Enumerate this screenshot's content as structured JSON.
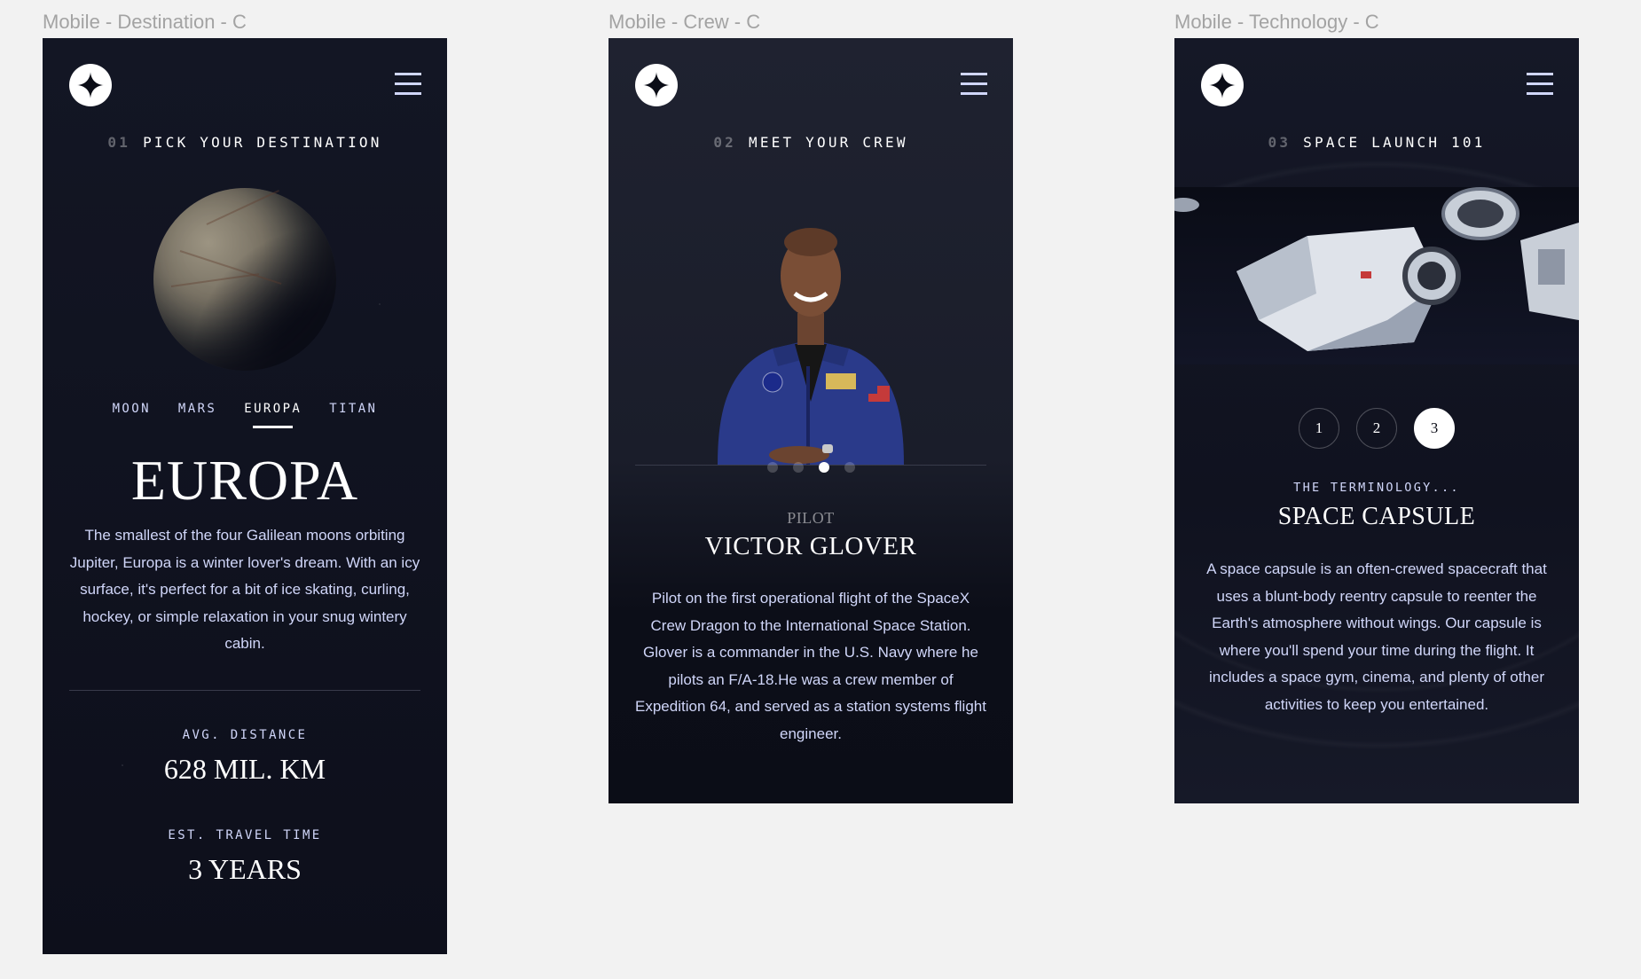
{
  "frames": {
    "destination": {
      "label": "Mobile - Destination - C",
      "eyebrow": {
        "number": "01",
        "text": "PICK YOUR DESTINATION"
      },
      "tabs": [
        "MOON",
        "MARS",
        "EUROPA",
        "TITAN"
      ],
      "active_tab": "EUROPA",
      "name": "EUROPA",
      "description": "The smallest of the four Galilean moons orbiting Jupiter, Europa is a winter lover's dream. With an icy surface, it's perfect for a bit of ice skating, curling, hockey, or simple relaxation in your snug wintery cabin.",
      "distance_label": "AVG. DISTANCE",
      "distance_value": "628 MIL. KM",
      "travel_label": "EST. TRAVEL TIME",
      "travel_value": "3 YEARS"
    },
    "crew": {
      "label": "Mobile - Crew - C",
      "eyebrow": {
        "number": "02",
        "text": "MEET YOUR CREW"
      },
      "dots_count": 4,
      "active_dot": 3,
      "role": "PILOT",
      "name": "VICTOR GLOVER",
      "bio": "Pilot on the first operational flight of the SpaceX Crew Dragon to the International Space Station. Glover is a commander in the U.S. Navy where he pilots an F/A-18.He was a crew member of Expedition 64, and served as a station systems flight engineer."
    },
    "technology": {
      "label": "Mobile - Technology - C",
      "eyebrow": {
        "number": "03",
        "text": "SPACE LAUNCH 101"
      },
      "steps": [
        "1",
        "2",
        "3"
      ],
      "active_step": "3",
      "terminology": "THE TERMINOLOGY...",
      "name": "SPACE CAPSULE",
      "description": "A space capsule is an often-crewed spacecraft that uses a blunt-body reentry capsule to reenter the Earth's atmosphere without wings. Our capsule is where you'll spend your time during the flight. It includes a space gym, cinema, and plenty of other activities to keep you entertained."
    }
  },
  "colors": {
    "canvas": "#f2f2f2",
    "dark": "#0b0d17",
    "light_blue": "#d0d6f9",
    "white": "#ffffff"
  },
  "icons": [
    "logo-star-icon",
    "hamburger-menu-icon"
  ]
}
